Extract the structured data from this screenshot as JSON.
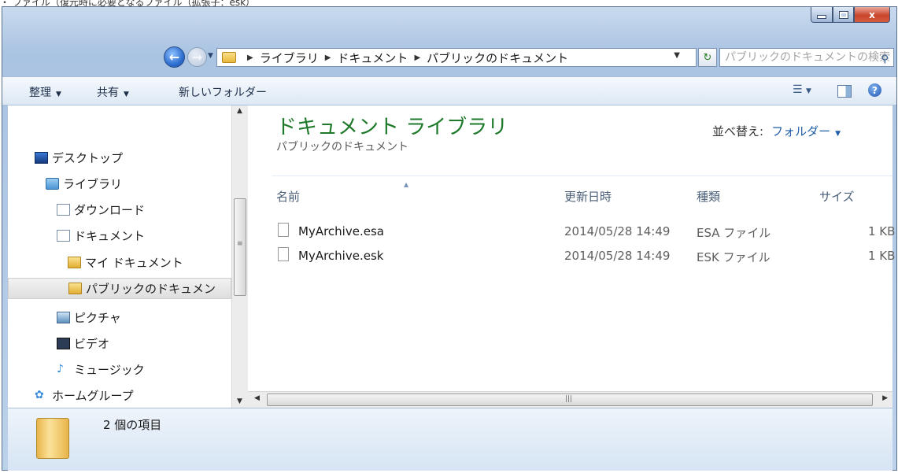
{
  "caption": "・ ファイル（復元時に必要となるファイル（拡張子：esk）",
  "window": {
    "controls": {
      "minimize": "–",
      "maximize": "□",
      "close": "x"
    }
  },
  "nav": {
    "back": "←",
    "forward": "→",
    "breadcrumbs": [
      "ライブラリ",
      "ドキュメント",
      "パブリックのドキュメント"
    ],
    "search_placeholder": "パブリックのドキュメントの検索",
    "refresh_icon": "↻"
  },
  "toolbar": {
    "organize": "整理",
    "share": "共有",
    "new_folder": "新しいフォルダー"
  },
  "sidebar": {
    "items": [
      {
        "label": "デスクトップ",
        "icon": "desktop-icon"
      },
      {
        "label": "ライブラリ",
        "icon": "library-icon"
      },
      {
        "label": "ダウンロード",
        "icon": "download-icon"
      },
      {
        "label": "ドキュメント",
        "icon": "document-icon"
      },
      {
        "label": "マイ ドキュメント",
        "icon": "folder-icon"
      },
      {
        "label": "パブリックのドキュメン",
        "icon": "folder-icon",
        "selected": true
      },
      {
        "label": "ピクチャ",
        "icon": "pictures-icon"
      },
      {
        "label": "ビデオ",
        "icon": "video-icon"
      },
      {
        "label": "ミュージック",
        "icon": "music-icon"
      },
      {
        "label": "ホームグループ",
        "icon": "homegroup-icon"
      }
    ]
  },
  "main": {
    "library_title": "ドキュメント ライブラリ",
    "library_subtitle": "パブリックのドキュメント",
    "sort_label": "並べ替え:",
    "sort_value": "フォルダー",
    "columns": [
      "名前",
      "更新日時",
      "種類",
      "サイズ"
    ],
    "files": [
      {
        "name": "MyArchive.esa",
        "modified": "2014/05/28 14:49",
        "type": "ESA ファイル",
        "size": "1 KB"
      },
      {
        "name": "MyArchive.esk",
        "modified": "2014/05/28 14:49",
        "type": "ESK ファイル",
        "size": "1 KB"
      }
    ]
  },
  "details": {
    "count": "2 個の項目"
  },
  "colors": {
    "library_title": "#1e7a2a",
    "link": "#1f5ea8",
    "close_button": "#c9452d"
  }
}
